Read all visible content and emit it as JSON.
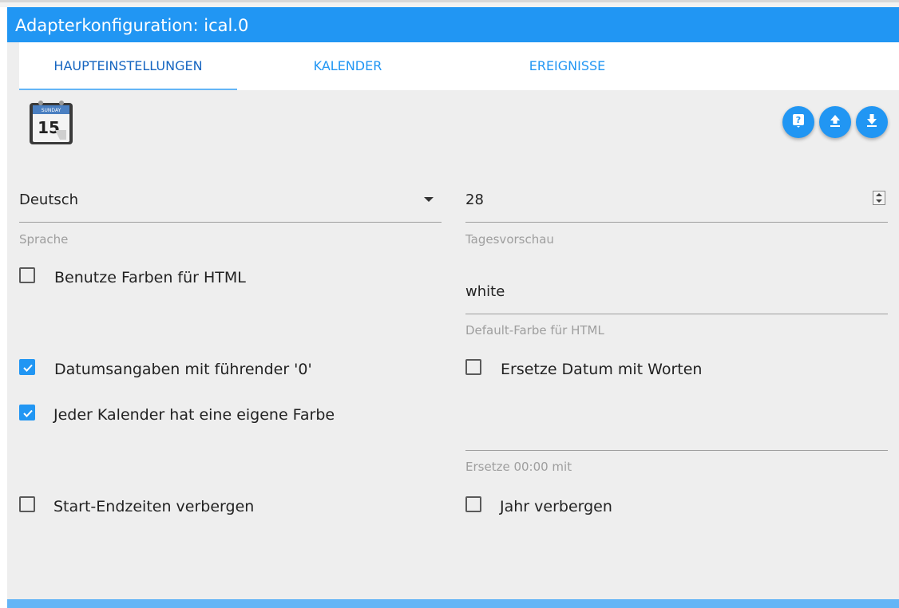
{
  "window": {
    "title": "Adapterkonfiguration: ical.0"
  },
  "tabs": [
    {
      "label": "HAUPTEINSTELLUNGEN",
      "active": true
    },
    {
      "label": "KALENDER",
      "active": false
    },
    {
      "label": "EREIGNISSE",
      "active": false
    }
  ],
  "logo": {
    "icon": "calendar-icon",
    "month": "SUNDAY",
    "day": "15"
  },
  "actions": [
    {
      "icon": "help-icon"
    },
    {
      "icon": "upload-icon"
    },
    {
      "icon": "download-icon"
    }
  ],
  "fields": {
    "language": {
      "value": "Deutsch",
      "label": "Sprache"
    },
    "days_preview": {
      "value": "28",
      "label": "Tagesvorschau"
    },
    "default_color": {
      "value": "white",
      "label": "Default-Farbe für HTML"
    },
    "replace_time": {
      "value": "",
      "label": "Ersetze 00:00 mit"
    }
  },
  "checkboxes": {
    "use_colors": {
      "label": "Benutze Farben für HTML",
      "checked": false
    },
    "leading_zero": {
      "label": "Datumsangaben mit führender '0'",
      "checked": true
    },
    "own_color": {
      "label": "Jeder Kalender hat eine eigene Farbe",
      "checked": true
    },
    "hide_times": {
      "label": "Start-Endzeiten verbergen",
      "checked": false
    },
    "replace_date": {
      "label": "Ersetze Datum mit Worten",
      "checked": false
    },
    "hide_year": {
      "label": "Jahr verbergen",
      "checked": false
    }
  },
  "colors": {
    "accent": "#2196f3",
    "background": "#eeeeee"
  }
}
